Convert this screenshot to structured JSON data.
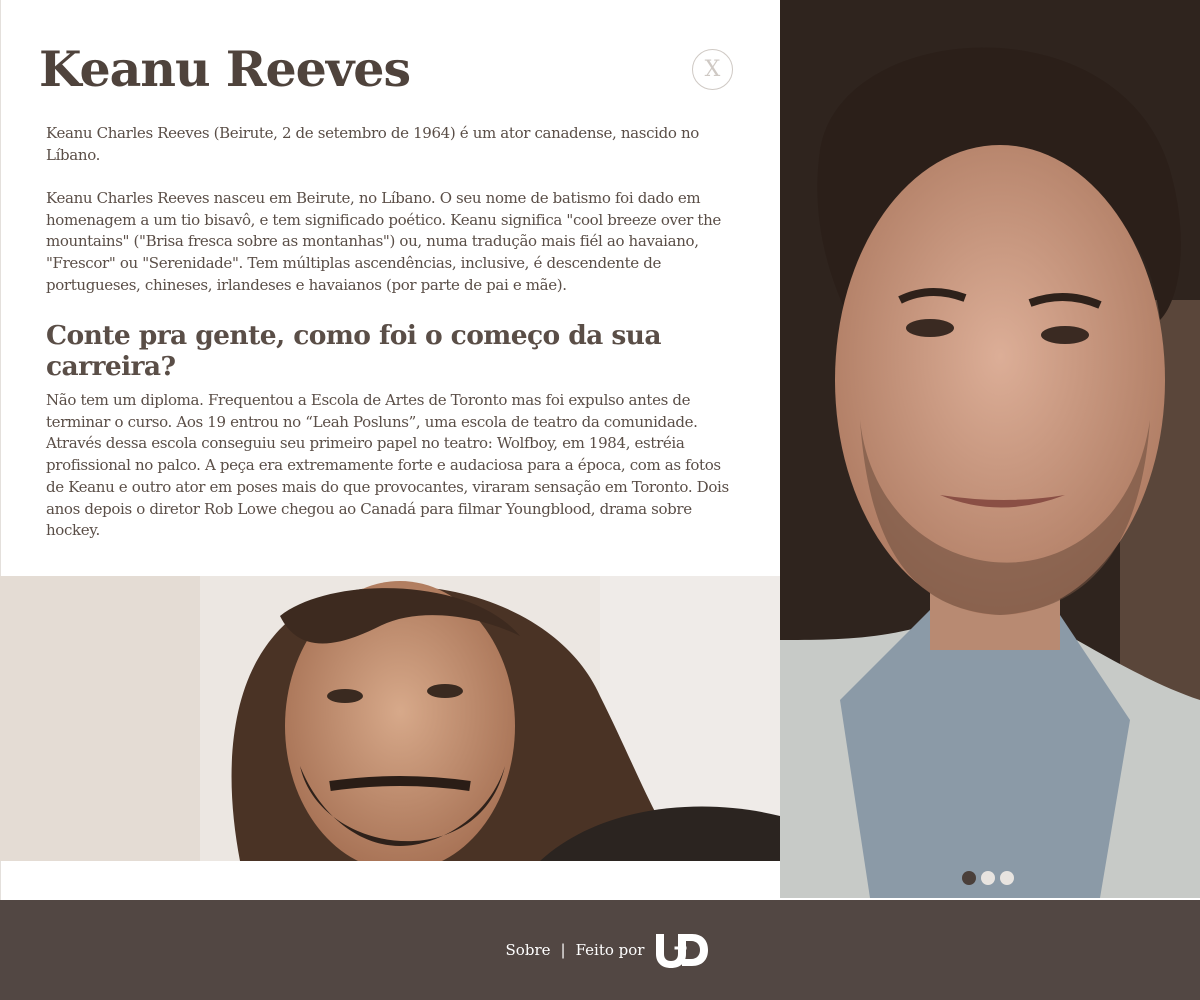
{
  "page": {
    "title": "Keanu Reeves",
    "close_label": "X"
  },
  "content": {
    "intro": "Keanu Charles Reeves (Beirute, 2 de setembro de 1964) é um ator canadense, nascido no Líbano.",
    "bio": "Keanu Charles Reeves nasceu em Beirute, no Líbano. O seu nome de batismo foi dado em homenagem a um tio bisavô, e tem significado poético. Keanu significa \"cool breeze over the mountains\" (\"Brisa fresca sobre as montanhas\") ou, numa tradução mais fiél ao havaiano, \"Frescor\" ou \"Serenidade\". Tem múltiplas ascendências, inclusive, é descendente de portugueses, chineses, irlandeses e havaianos (por parte de pai e mãe).",
    "question": "Conte pra gente, como foi o começo da sua carreira?",
    "answer": "Não tem um diploma. Frequentou a Escola de Artes de Toronto mas foi expulso antes de terminar o curso. Aos 19 entrou no “Leah Posluns”, uma escola de teatro da comunidade. Através dessa escola conseguiu seu primeiro papel no teatro: Wolfboy, em 1984, estréia profissional no palco. A peça era extremamente forte e audaciosa para a época, com as fotos de Keanu e outro ator em poses mais do que provocantes, viraram sensação em Toronto. Dois anos depois o diretor Rob Lowe chegou ao Canadá para filmar Youngblood, drama sobre hockey."
  },
  "carousel": {
    "active_index": 0,
    "slide_count": 3
  },
  "footer": {
    "about": "Sobre",
    "separator": "|",
    "made_by": "Feito por",
    "logo_text": "U+D"
  },
  "colors": {
    "text": "#5a4e47",
    "title": "#4f433c",
    "footer_bg": "#524743",
    "dot_active": "#4a3f3a",
    "dot_inactive": "#e8e4e0"
  }
}
